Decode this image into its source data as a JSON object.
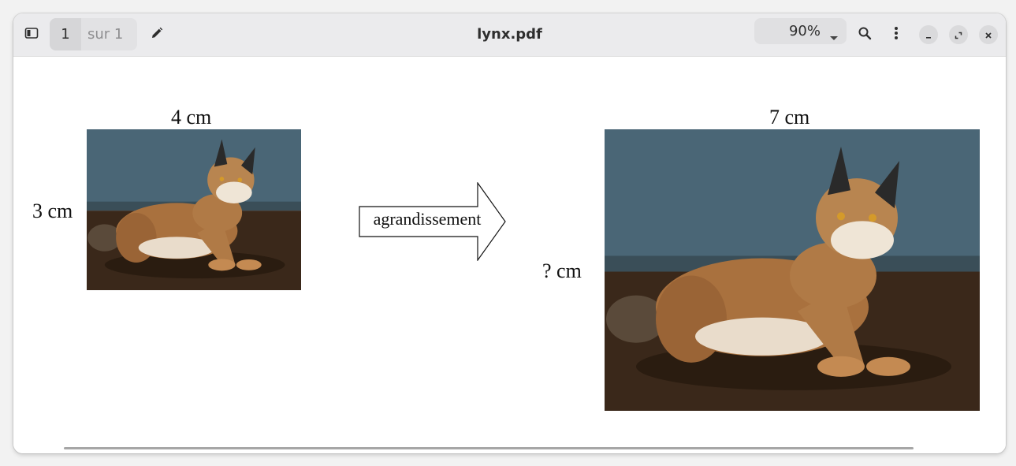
{
  "window": {
    "title": "lynx.pdf",
    "page_current": "1",
    "page_of": "sur 1",
    "zoom": "90%",
    "icons": {
      "sidebar": "sidebar-toggle-icon",
      "edit": "pencil-icon",
      "zoom_caret": "chevron-down-icon",
      "search": "search-icon",
      "menu": "kebab-menu-icon",
      "minimize": "minimize-icon",
      "maximize": "maximize-icon",
      "close": "close-icon"
    }
  },
  "document": {
    "small": {
      "width_label": "4 cm",
      "height_label": "3 cm"
    },
    "arrow_label": "agrandissement",
    "large": {
      "width_label": "7 cm",
      "height_label": "? cm"
    }
  },
  "colors": {
    "headerbar": "#ebebed",
    "photo_wall": "#4a6676",
    "photo_ground": "#3a281a",
    "lynx_fur": "#a9713e"
  }
}
